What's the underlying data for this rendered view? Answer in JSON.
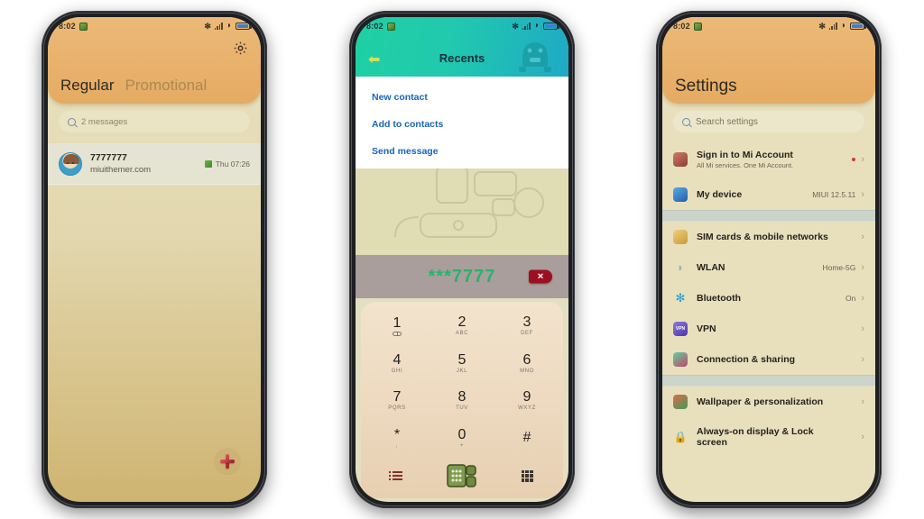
{
  "theme": {
    "header_orange": "#e8b067",
    "list_cream": "#e8e0bd",
    "teal_header": "#1fc9ac",
    "accent_green": "#27b36a",
    "chevron_green": "#8fae6d",
    "delete_red": "#9b1020",
    "link_blue": "#1565c0"
  },
  "status_bar": {
    "time": "8:02",
    "icons": [
      "app-badge-icon",
      "bluetooth-icon",
      "signal-icon",
      "wifi-icon",
      "battery-icon"
    ]
  },
  "phone1": {
    "app": "Messages",
    "header": {
      "settings_icon": "gear-icon",
      "tabs": [
        {
          "label": "Regular",
          "active": true
        },
        {
          "label": "Promotional",
          "active": false
        }
      ]
    },
    "search": {
      "placeholder": "2 messages",
      "icon": "search-icon"
    },
    "conversations": [
      {
        "avatar": "contact-avatar",
        "title": "7777777",
        "subtitle": "miuithemer.com",
        "time": "Thu 07:26",
        "meta_icon": "report-icon"
      }
    ],
    "fab": {
      "icon": "plus-icon",
      "label": "New message"
    }
  },
  "phone2": {
    "app": "Dialer",
    "header": {
      "back_icon": "back-arrow-icon",
      "title": "Recents",
      "mascot_icon": "robot-mascot-icon"
    },
    "popup_menu": [
      "New contact",
      "Add to contacts",
      "Send message"
    ],
    "dial_display": {
      "number": "***7777",
      "delete_icon": "delete-backspace-icon"
    },
    "keypad": [
      {
        "num": "1",
        "sub": "",
        "sub_icon": "voicemail-icon"
      },
      {
        "num": "2",
        "sub": "ABC"
      },
      {
        "num": "3",
        "sub": "DEF"
      },
      {
        "num": "4",
        "sub": "GHI"
      },
      {
        "num": "5",
        "sub": "JKL"
      },
      {
        "num": "6",
        "sub": "MNO"
      },
      {
        "num": "7",
        "sub": "PQRS"
      },
      {
        "num": "8",
        "sub": "TUV"
      },
      {
        "num": "9",
        "sub": "WXYZ"
      },
      {
        "num": "*",
        "sub": ","
      },
      {
        "num": "0",
        "sub": "+"
      },
      {
        "num": "#",
        "sub": ""
      }
    ],
    "bottom_bar": {
      "left_icon": "call-log-icon",
      "center_icon": "call-button-icon",
      "right_icon": "keypad-icon"
    }
  },
  "phone3": {
    "app": "Settings",
    "header": {
      "title": "Settings"
    },
    "search": {
      "placeholder": "Search settings",
      "icon": "search-icon"
    },
    "groups": [
      {
        "items": [
          {
            "icon": "mi-account-icon",
            "label": "Sign in to Mi Account",
            "desc": "All Mi services. One Mi Account.",
            "value": "",
            "badge": true,
            "tall": true
          },
          {
            "icon": "my-device-icon",
            "label": "My device",
            "desc": "",
            "value": "MIUI 12.5.11",
            "badge": false,
            "tall": false
          }
        ]
      },
      {
        "items": [
          {
            "icon": "sim-card-icon",
            "label": "SIM cards & mobile networks",
            "desc": "",
            "value": "",
            "badge": false,
            "tall": false
          },
          {
            "icon": "wlan-icon",
            "label": "WLAN",
            "desc": "",
            "value": "Home-5G",
            "badge": false,
            "tall": false
          },
          {
            "icon": "bluetooth-icon",
            "label": "Bluetooth",
            "desc": "",
            "value": "On",
            "badge": false,
            "tall": false
          },
          {
            "icon": "vpn-icon",
            "label": "VPN",
            "desc": "",
            "value": "",
            "badge": false,
            "tall": false
          },
          {
            "icon": "connection-sharing-icon",
            "label": "Connection & sharing",
            "desc": "",
            "value": "",
            "badge": false,
            "tall": false
          }
        ]
      },
      {
        "items": [
          {
            "icon": "wallpaper-icon",
            "label": "Wallpaper & personalization",
            "desc": "",
            "value": "",
            "badge": false,
            "tall": false
          },
          {
            "icon": "lock-screen-icon",
            "label": "Always-on display & Lock screen",
            "desc": "",
            "value": "",
            "badge": false,
            "tall": true
          }
        ]
      }
    ],
    "chevron": "›"
  }
}
